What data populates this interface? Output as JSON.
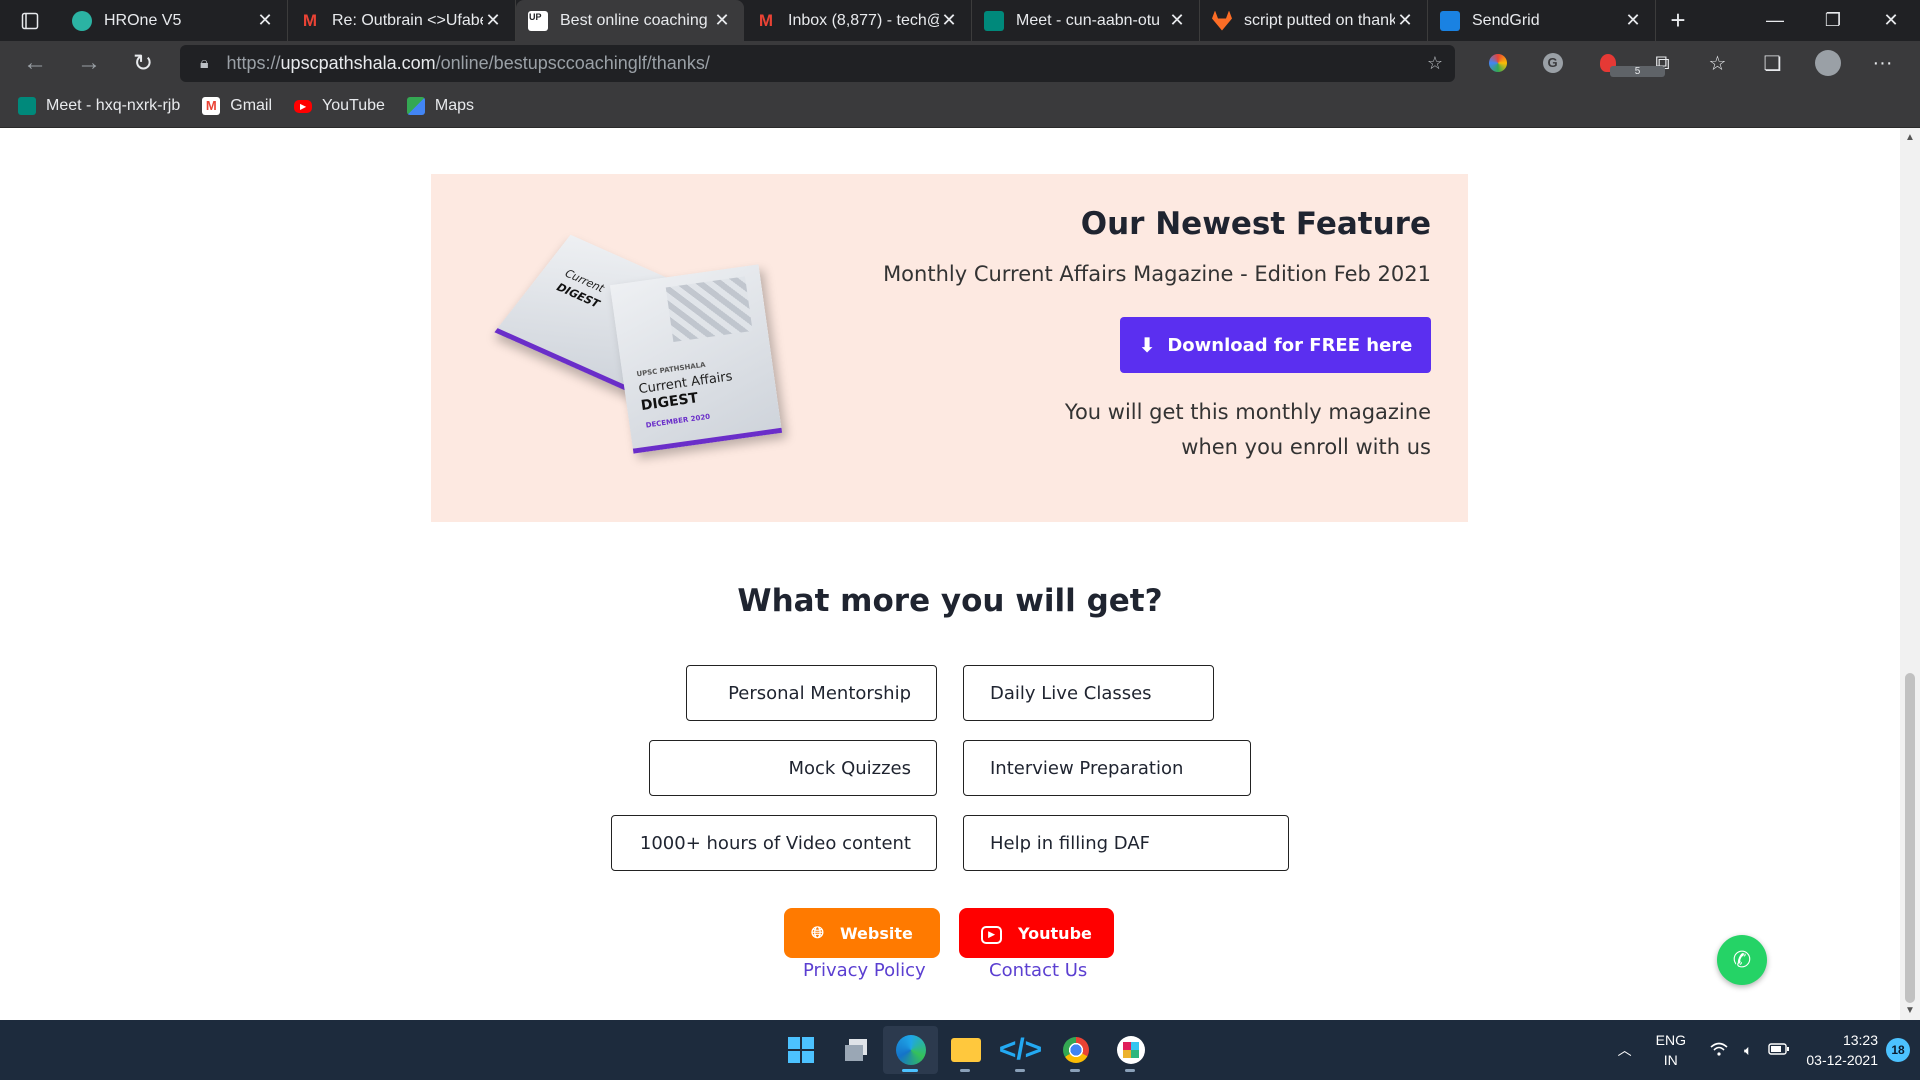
{
  "browser": {
    "tabs": [
      {
        "title": "HROne V5",
        "icon": "hrone-icon",
        "color": "#2bb3a3"
      },
      {
        "title": "Re: Outbrain <>Ufabe",
        "icon": "gmail-icon",
        "color": "#ea4335"
      },
      {
        "title": "Best online coaching f",
        "icon": "upsc-icon",
        "color": "#ffffff"
      },
      {
        "title": "Inbox (8,877) - tech@",
        "icon": "gmail-icon",
        "color": "#ea4335"
      },
      {
        "title": "Meet - cun-aabn-otu",
        "icon": "meet-icon",
        "color": "#00897b"
      },
      {
        "title": "script putted on thank",
        "icon": "gitlab-icon",
        "color": "#fc6d26"
      },
      {
        "title": "SendGrid",
        "icon": "sendgrid-icon",
        "color": "#1a82e2"
      }
    ],
    "url_prefix": "https://",
    "url_host": "upscpathshala.com",
    "url_path": "/online/bestupsccoachinglf/thanks/",
    "bookmarks": [
      {
        "label": "Meet - hxq-nxrk-rjb",
        "icon": "meet-icon",
        "color": "#00897b"
      },
      {
        "label": "Gmail",
        "icon": "gmail-icon",
        "color": "#ea4335"
      },
      {
        "label": "YouTube",
        "icon": "youtube-icon",
        "color": "#ff0000"
      },
      {
        "label": "Maps",
        "icon": "maps-icon",
        "color": "#34a853"
      }
    ],
    "extension_badge": "5"
  },
  "feature": {
    "heading": "Our Newest Feature",
    "subtitle": "Monthly Current Affairs Magazine - Edition Feb 2021",
    "download_label": "Download for FREE here",
    "note_line1": "You will get this monthly magazine",
    "note_line2": "when you enroll with us",
    "magazine": {
      "brand": "UPSC PATHSHALA",
      "title_line1": "Current Affairs",
      "title_line2": "DIGEST",
      "edition": "DECEMBER 2020",
      "back_line1": "Current",
      "back_line2": "DIGEST"
    }
  },
  "benefits": {
    "title": "What more you will get?",
    "items": [
      "Personal Mentorship",
      "Daily Live Classes",
      "Mock Quizzes",
      "Interview Preparation",
      "1000+ hours of Video content",
      "Help in filling DAF"
    ]
  },
  "social": {
    "website_label": "Website",
    "youtube_label": "Youtube",
    "website_color": "#ff7a00",
    "youtube_color": "#ff0000"
  },
  "footer": {
    "privacy": "Privacy Policy",
    "contact": "Contact Us"
  },
  "taskbar": {
    "lang_line1": "ENG",
    "lang_line2": "IN",
    "time": "13:23",
    "date": "03-12-2021",
    "notifications": "18"
  }
}
